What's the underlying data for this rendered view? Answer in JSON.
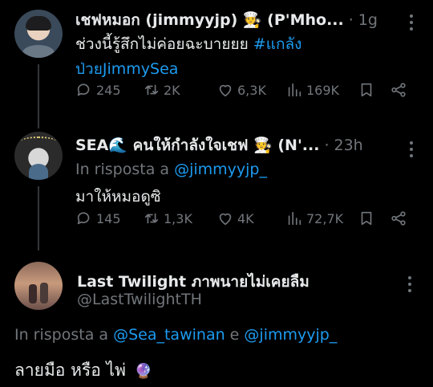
{
  "tweets": [
    {
      "display_name": "เชฟหมอก (jimmyyjp) 🧑‍🍳 (P'Mho...",
      "time": "1g",
      "text_plain": "ช่วงนี้รู้สึกไม่ค่อยฉะบายยย ",
      "hashtag_part1": "#แกลัง",
      "hashtag_part2": "ป่วยJimmySea",
      "stats": {
        "replies": "245",
        "retweets": "2K",
        "likes": "6,3K",
        "views": "169K"
      }
    },
    {
      "display_name": "SEA🌊 คนให้กำลังใจเชฟ 🧑‍🍳 (N'...",
      "time": "23h",
      "reply_prefix": "In risposta a",
      "reply_to": "@jimmyyjp_",
      "text": "มาให้หมอดูซิ",
      "stats": {
        "replies": "145",
        "retweets": "1,3K",
        "likes": "4K",
        "views": "72,7K"
      }
    },
    {
      "display_name": "Last Twilight ภาพนายไม่เคยลืม",
      "handle": "@LastTwilightTH",
      "reply_prefix": "In risposta a",
      "reply_to_1": "@Sea_tawinan",
      "reply_joiner": "e",
      "reply_to_2": "@jimmyyjp_",
      "text": "ลายมือ หรือ ไพ่",
      "emoji": "🔮"
    }
  ],
  "icons": [
    "reply-icon",
    "retweet-icon",
    "like-icon",
    "views-icon",
    "bookmark-icon",
    "share-icon",
    "more-icon"
  ],
  "colors": {
    "background": "#000000",
    "text": "#e7e9ea",
    "muted": "#71767b",
    "link": "#1d9bf0"
  }
}
